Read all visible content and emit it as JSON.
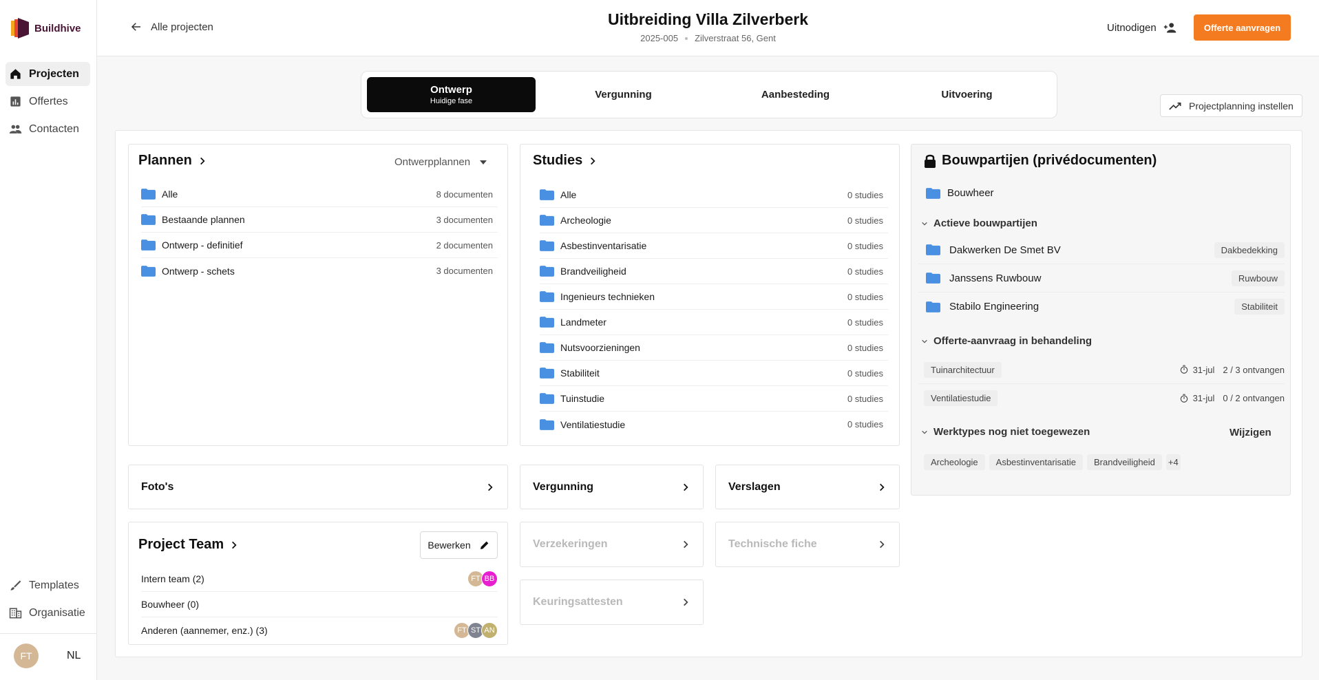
{
  "app": {
    "name": "Buildhive"
  },
  "nav": {
    "items": [
      {
        "label": "Projecten"
      },
      {
        "label": "Offertes"
      },
      {
        "label": "Contacten"
      }
    ],
    "bottom": [
      {
        "label": "Templates"
      },
      {
        "label": "Organisatie"
      }
    ],
    "user_initials": "FT",
    "language": "NL"
  },
  "header": {
    "back_label": "Alle projecten",
    "title": "Uitbreiding Villa Zilverberk",
    "project_number": "2025-005",
    "address": "Zilverstraat 56, Gent",
    "invite_label": "Uitnodigen",
    "quote_button": "Offerte aanvragen"
  },
  "phases": {
    "items": [
      {
        "label": "Ontwerp",
        "sub": "Huidige fase"
      },
      {
        "label": "Vergunning"
      },
      {
        "label": "Aanbesteding"
      },
      {
        "label": "Uitvoering"
      }
    ],
    "planning_button": "Projectplanning instellen"
  },
  "plannen": {
    "title": "Plannen",
    "filter": "Ontwerpplannen",
    "rows": [
      {
        "label": "Alle",
        "count": "8 documenten"
      },
      {
        "label": "Bestaande plannen",
        "count": "3 documenten"
      },
      {
        "label": "Ontwerp - definitief",
        "count": "2 documenten"
      },
      {
        "label": "Ontwerp - schets",
        "count": "3 documenten"
      }
    ]
  },
  "studies": {
    "title": "Studies",
    "rows": [
      {
        "label": "Alle",
        "count": "0 studies"
      },
      {
        "label": "Archeologie",
        "count": "0 studies"
      },
      {
        "label": "Asbestinventarisatie",
        "count": "0 studies"
      },
      {
        "label": "Brandveiligheid",
        "count": "0 studies"
      },
      {
        "label": "Ingenieurs technieken",
        "count": "0 studies"
      },
      {
        "label": "Landmeter",
        "count": "0 studies"
      },
      {
        "label": "Nutsvoorzieningen",
        "count": "0 studies"
      },
      {
        "label": "Stabiliteit",
        "count": "0 studies"
      },
      {
        "label": "Tuinstudie",
        "count": "0 studies"
      },
      {
        "label": "Ventilatiestudie",
        "count": "0 studies"
      }
    ]
  },
  "bouwpartijen": {
    "title": "Bouwpartijen (privédocumenten)",
    "bouwheer": "Bouwheer",
    "active_title": "Actieve bouwpartijen",
    "active": [
      {
        "name": "Dakwerken De Smet BV",
        "tag": "Dakbedekking"
      },
      {
        "name": "Janssens Ruwbouw",
        "tag": "Ruwbouw"
      },
      {
        "name": "Stabilo Engineering",
        "tag": "Stabiliteit"
      }
    ],
    "pending_title": "Offerte-aanvraag in behandeling",
    "pending": [
      {
        "tag": "Tuinarchitectuur",
        "date": "31-jul",
        "received": "2 / 3 ontvangen"
      },
      {
        "tag": "Ventilatiestudie",
        "date": "31-jul",
        "received": "0 / 2 ontvangen"
      }
    ],
    "unassigned_title": "Werktypes nog niet toegewezen",
    "edit_label": "Wijzigen",
    "unassigned": [
      "Archeologie",
      "Asbestinventarisatie",
      "Brandveiligheid"
    ],
    "more": "+4"
  },
  "cards": {
    "fotos": "Foto's",
    "vergunning": "Vergunning",
    "verslagen": "Verslagen",
    "verzekeringen": "Verzekeringen",
    "technische_fiche": "Technische fiche",
    "keuringsattesten": "Keuringsattesten"
  },
  "team": {
    "title": "Project Team",
    "edit_label": "Bewerken",
    "rows": [
      {
        "label": "Intern team (2)",
        "avatars": [
          "FT",
          "BB"
        ]
      },
      {
        "label": "Bouwheer (0)",
        "avatars": []
      },
      {
        "label": "Anderen (aannemer, enz.) (3)",
        "avatars": [
          "FT",
          "ST",
          "AN"
        ]
      }
    ]
  },
  "colors": {
    "accent": "#f47b20",
    "folder": "#4a90e2",
    "brand": "#4a1535"
  }
}
